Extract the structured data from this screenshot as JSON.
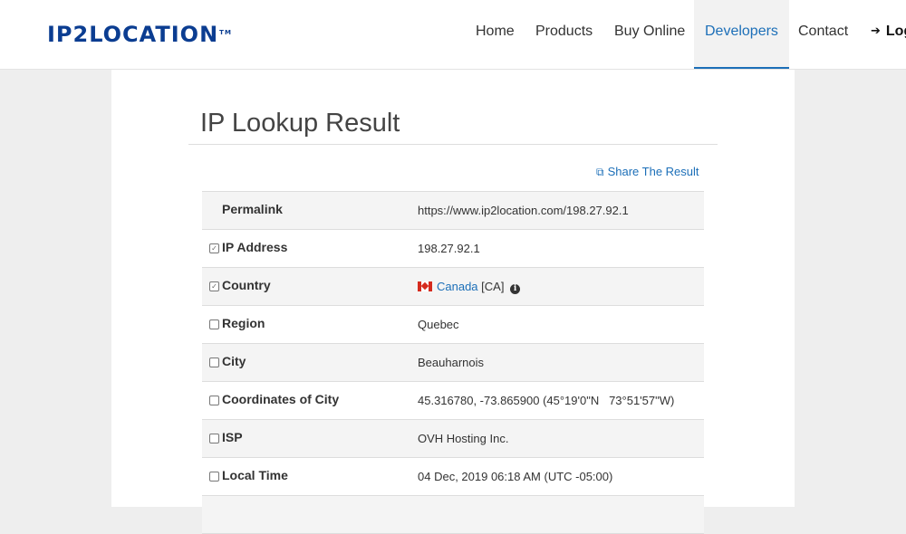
{
  "header": {
    "logo_text": "IP2LOCATION",
    "logo_tm": "TM",
    "nav": [
      {
        "label": "Home"
      },
      {
        "label": "Products"
      },
      {
        "label": "Buy Online"
      },
      {
        "label": "Developers",
        "active": true
      },
      {
        "label": "Contact"
      },
      {
        "label": "Log"
      }
    ]
  },
  "page": {
    "title": "IP Lookup Result",
    "share_label": "Share The Result"
  },
  "results": [
    {
      "label": "Permalink",
      "value": "https://www.ip2location.com/198.27.92.1",
      "checkbox": "none"
    },
    {
      "label": "IP Address",
      "value": "198.27.92.1",
      "checkbox": "checked"
    },
    {
      "label": "Country",
      "value": "Canada",
      "code": "[CA]",
      "checkbox": "checked"
    },
    {
      "label": "Region",
      "value": "Quebec",
      "checkbox": "unchecked"
    },
    {
      "label": "City",
      "value": "Beauharnois",
      "checkbox": "unchecked"
    },
    {
      "label": "Coordinates of City",
      "value": "45.316780, -73.865900 (45°19'0\"N   73°51'57\"W)",
      "checkbox": "unchecked"
    },
    {
      "label": "ISP",
      "value": "OVH Hosting Inc.",
      "checkbox": "unchecked"
    },
    {
      "label": "Local Time",
      "value": "04 Dec, 2019 06:18 AM (UTC -05:00)",
      "checkbox": "unchecked"
    }
  ],
  "colors": {
    "brand": "#0b3d91",
    "link": "#1c6fb8",
    "page_bg": "#eeeeee"
  }
}
